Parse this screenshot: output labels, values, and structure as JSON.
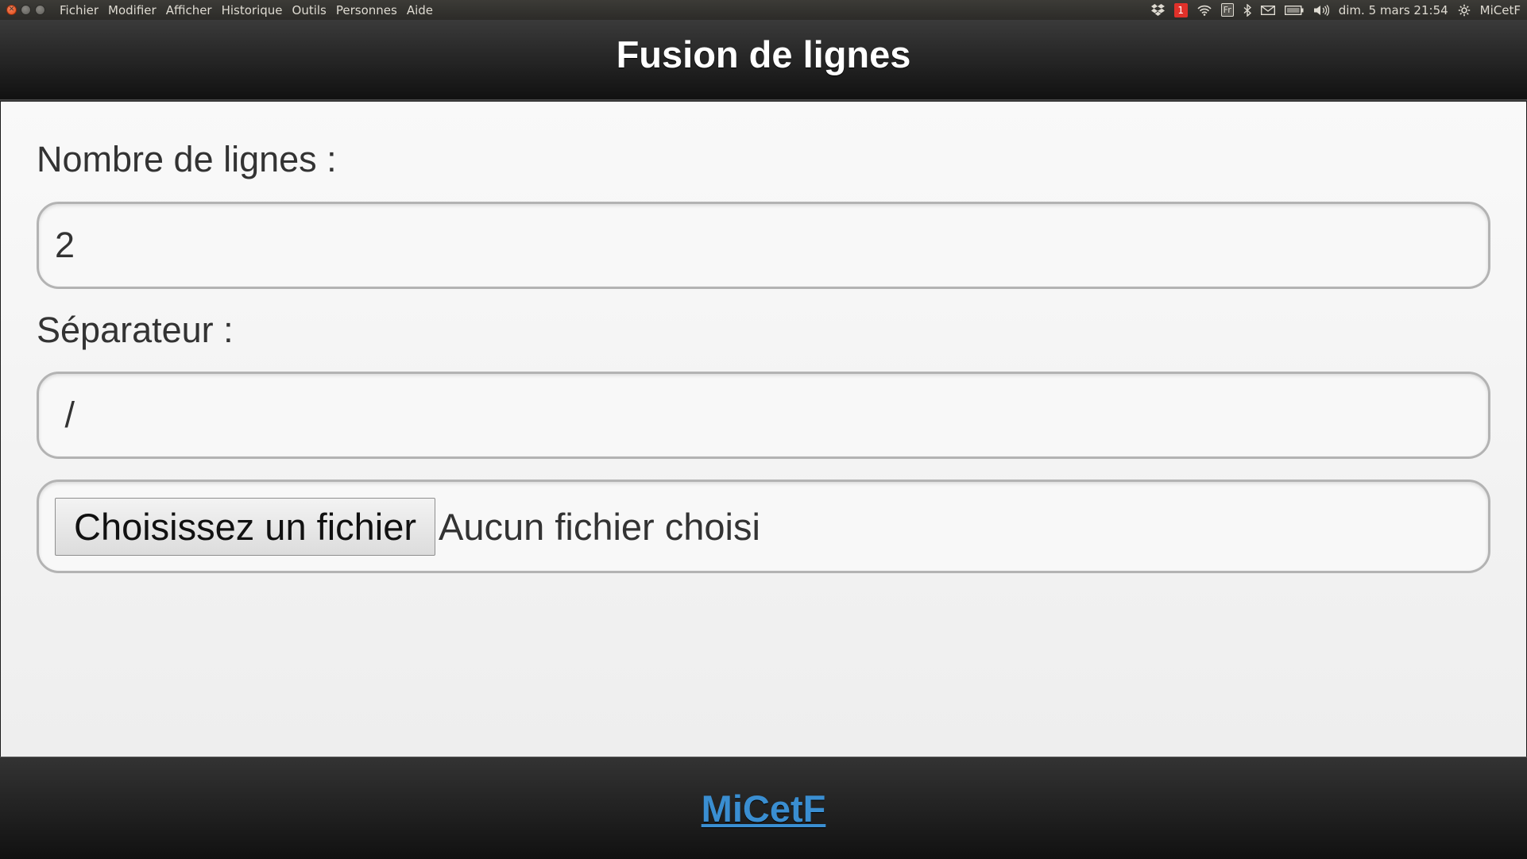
{
  "os_panel": {
    "menu": [
      "Fichier",
      "Modifier",
      "Afficher",
      "Historique",
      "Outils",
      "Personnes",
      "Aide"
    ],
    "tray": {
      "notification_count": "1",
      "keyboard_layout": "Fr",
      "datetime": "dim. 5 mars 21:54",
      "user": "MiCetF"
    }
  },
  "header": {
    "title": "Fusion de lignes"
  },
  "form": {
    "lines_label": "Nombre de lignes :",
    "lines_value": "2",
    "separator_label": "Séparateur :",
    "separator_value": " /",
    "file_button_label": "Choisissez un fichier",
    "file_status": "Aucun fichier choisi"
  },
  "footer": {
    "link_text": "MiCetF",
    "link_color": "#3a8ed1"
  },
  "colors": {
    "header_bg": "#1b1b1b",
    "content_bg": "#f5f5f5",
    "badge_red": "#e0312a"
  }
}
